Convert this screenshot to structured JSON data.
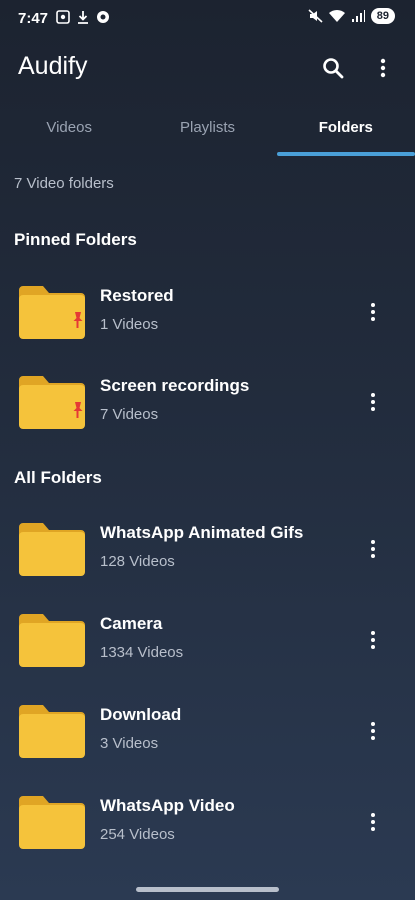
{
  "status": {
    "time": "7:47",
    "battery": "89"
  },
  "app": {
    "title": "Audify"
  },
  "tabs": [
    {
      "label": "Videos"
    },
    {
      "label": "Playlists"
    },
    {
      "label": "Folders"
    }
  ],
  "summary": "7 Video folders",
  "pinned": {
    "heading": "Pinned Folders",
    "items": [
      {
        "name": "Restored",
        "count": "1 Videos"
      },
      {
        "name": "Screen recordings",
        "count": "7 Videos"
      }
    ]
  },
  "all": {
    "heading": "All Folders",
    "items": [
      {
        "name": "WhatsApp Animated Gifs",
        "count": "128 Videos"
      },
      {
        "name": "Camera",
        "count": "1334 Videos"
      },
      {
        "name": "Download",
        "count": "3 Videos"
      },
      {
        "name": "WhatsApp Video",
        "count": "254 Videos"
      }
    ]
  },
  "colors": {
    "accent": "#4a9fd8",
    "folder": "#f5c33b",
    "pin": "#e53935"
  }
}
